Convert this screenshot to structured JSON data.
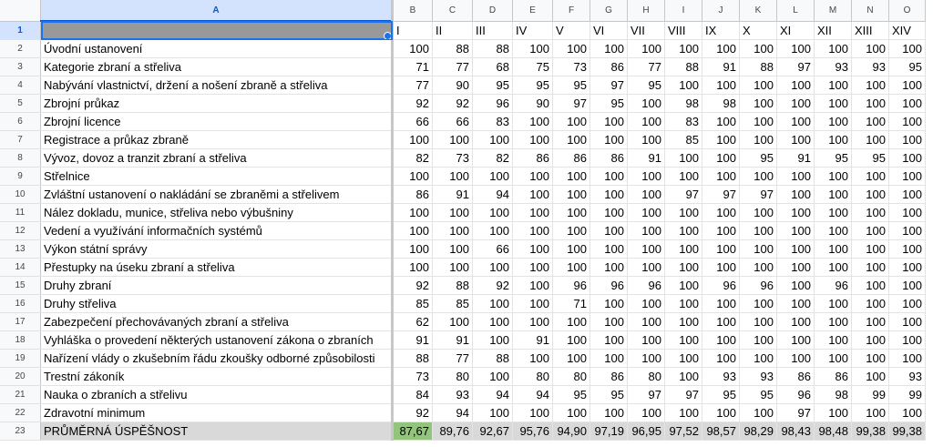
{
  "columns": [
    "A",
    "B",
    "C",
    "D",
    "E",
    "F",
    "G",
    "H",
    "I",
    "J",
    "K",
    "L",
    "M",
    "N",
    "O"
  ],
  "header_row": {
    "a": "",
    "terms": [
      "I",
      "II",
      "III",
      "IV",
      "V",
      "VI",
      "VII",
      "VIII",
      "IX",
      "X",
      "XI",
      "XII",
      "XIII",
      "XIV"
    ]
  },
  "rows": [
    {
      "num": "2",
      "label": "Úvodní ustanovení",
      "values": [
        "100",
        "88",
        "88",
        "100",
        "100",
        "100",
        "100",
        "100",
        "100",
        "100",
        "100",
        "100",
        "100",
        "100"
      ]
    },
    {
      "num": "3",
      "label": "Kategorie zbraní a střeliva",
      "values": [
        "71",
        "77",
        "68",
        "75",
        "73",
        "86",
        "77",
        "88",
        "91",
        "88",
        "97",
        "93",
        "93",
        "95"
      ]
    },
    {
      "num": "4",
      "label": "Nabývání vlastnictví, držení a nošení zbraně a střeliva",
      "values": [
        "77",
        "90",
        "95",
        "95",
        "95",
        "97",
        "95",
        "100",
        "100",
        "100",
        "100",
        "100",
        "100",
        "100"
      ]
    },
    {
      "num": "5",
      "label": "Zbrojní průkaz",
      "values": [
        "92",
        "92",
        "96",
        "90",
        "97",
        "95",
        "100",
        "98",
        "98",
        "100",
        "100",
        "100",
        "100",
        "100"
      ]
    },
    {
      "num": "6",
      "label": "Zbrojní licence",
      "values": [
        "66",
        "66",
        "83",
        "100",
        "100",
        "100",
        "100",
        "83",
        "100",
        "100",
        "100",
        "100",
        "100",
        "100"
      ]
    },
    {
      "num": "7",
      "label": "Registrace a průkaz zbraně",
      "values": [
        "100",
        "100",
        "100",
        "100",
        "100",
        "100",
        "100",
        "85",
        "100",
        "100",
        "100",
        "100",
        "100",
        "100"
      ]
    },
    {
      "num": "8",
      "label": "Vývoz, dovoz a tranzit zbraní a střeliva",
      "values": [
        "82",
        "73",
        "82",
        "86",
        "86",
        "86",
        "91",
        "100",
        "100",
        "95",
        "91",
        "95",
        "95",
        "100"
      ]
    },
    {
      "num": "9",
      "label": "Střelnice",
      "values": [
        "100",
        "100",
        "100",
        "100",
        "100",
        "100",
        "100",
        "100",
        "100",
        "100",
        "100",
        "100",
        "100",
        "100"
      ]
    },
    {
      "num": "10",
      "label": "Zvláštní ustanovení o nakládání se zbraněmi a střelivem",
      "values": [
        "86",
        "91",
        "94",
        "100",
        "100",
        "100",
        "100",
        "97",
        "97",
        "97",
        "100",
        "100",
        "100",
        "100"
      ]
    },
    {
      "num": "11",
      "label": "Nález dokladu, munice, střeliva nebo výbušniny",
      "values": [
        "100",
        "100",
        "100",
        "100",
        "100",
        "100",
        "100",
        "100",
        "100",
        "100",
        "100",
        "100",
        "100",
        "100"
      ]
    },
    {
      "num": "12",
      "label": "Vedení a využívání informačních systémů",
      "values": [
        "100",
        "100",
        "100",
        "100",
        "100",
        "100",
        "100",
        "100",
        "100",
        "100",
        "100",
        "100",
        "100",
        "100"
      ]
    },
    {
      "num": "13",
      "label": "Výkon státní správy",
      "values": [
        "100",
        "100",
        "66",
        "100",
        "100",
        "100",
        "100",
        "100",
        "100",
        "100",
        "100",
        "100",
        "100",
        "100"
      ]
    },
    {
      "num": "14",
      "label": "Přestupky na úseku zbraní a střeliva",
      "values": [
        "100",
        "100",
        "100",
        "100",
        "100",
        "100",
        "100",
        "100",
        "100",
        "100",
        "100",
        "100",
        "100",
        "100"
      ]
    },
    {
      "num": "15",
      "label": "Druhy zbraní",
      "values": [
        "92",
        "88",
        "92",
        "100",
        "96",
        "96",
        "96",
        "100",
        "96",
        "96",
        "100",
        "96",
        "100",
        "100"
      ]
    },
    {
      "num": "16",
      "label": "Druhy střeliva",
      "values": [
        "85",
        "85",
        "100",
        "100",
        "71",
        "100",
        "100",
        "100",
        "100",
        "100",
        "100",
        "100",
        "100",
        "100"
      ]
    },
    {
      "num": "17",
      "label": "Zabezpečení přechovávaných zbraní a střeliva",
      "values": [
        "62",
        "100",
        "100",
        "100",
        "100",
        "100",
        "100",
        "100",
        "100",
        "100",
        "100",
        "100",
        "100",
        "100"
      ]
    },
    {
      "num": "18",
      "label": "Vyhláška o provedení některých ustanovení zákona o zbraních",
      "values": [
        "91",
        "91",
        "100",
        "91",
        "100",
        "100",
        "100",
        "100",
        "100",
        "100",
        "100",
        "100",
        "100",
        "100"
      ]
    },
    {
      "num": "19",
      "label": "Nařízení vlády o zkušebním řádu zkoušky odborné způsobilosti",
      "values": [
        "88",
        "77",
        "88",
        "100",
        "100",
        "100",
        "100",
        "100",
        "100",
        "100",
        "100",
        "100",
        "100",
        "100"
      ]
    },
    {
      "num": "20",
      "label": "Trestní zákoník",
      "values": [
        "73",
        "80",
        "100",
        "80",
        "80",
        "86",
        "80",
        "100",
        "93",
        "93",
        "86",
        "86",
        "100",
        "93"
      ]
    },
    {
      "num": "21",
      "label": "Nauka o zbraních a střelivu",
      "values": [
        "84",
        "93",
        "94",
        "94",
        "95",
        "95",
        "97",
        "97",
        "95",
        "95",
        "96",
        "98",
        "99",
        "99"
      ]
    },
    {
      "num": "22",
      "label": "Zdravotní minimum",
      "values": [
        "92",
        "94",
        "100",
        "100",
        "100",
        "100",
        "100",
        "100",
        "100",
        "100",
        "97",
        "100",
        "100",
        "100"
      ]
    }
  ],
  "average_row": {
    "num": "23",
    "label": "PRŮMĚRNÁ ÚSPĚŠNOST",
    "values": [
      "87,67",
      "89,76",
      "92,67",
      "95,76",
      "94,90",
      "97,19",
      "96,95",
      "97,52",
      "98,57",
      "98,29",
      "98,43",
      "98,48",
      "99,38",
      "99,38"
    ]
  },
  "colors": {
    "selected_cell": "#999999",
    "selection_blue": "#1a73e8",
    "average_row": "#d9d9d9",
    "highlight_green": "#93c47d"
  }
}
